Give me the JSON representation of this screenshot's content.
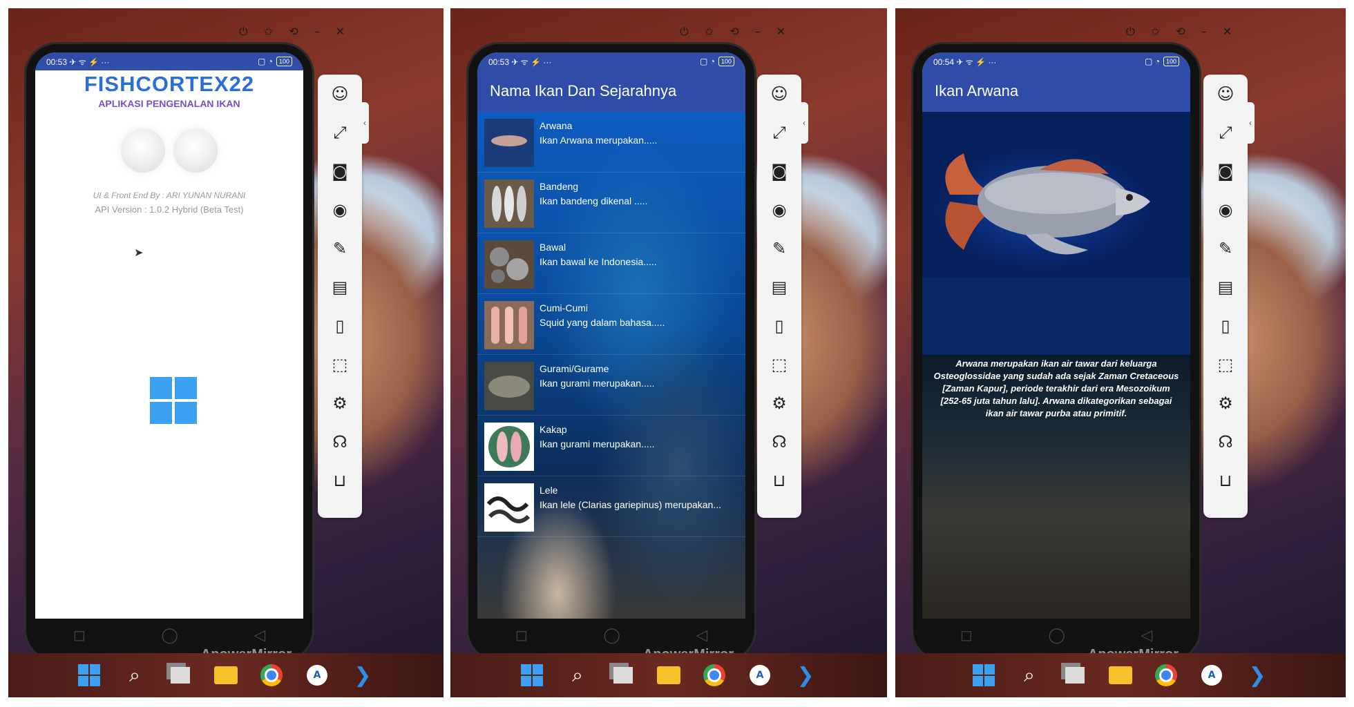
{
  "window_controls": "⏻ ✩ ⟲ – ✕",
  "status": {
    "time_1": "00:53",
    "time_2": "00:53",
    "time_3": "00:54",
    "battery": "100",
    "icons_left": "✈ ᯤ ⚡ ···",
    "icons_right": "▢ ◔"
  },
  "watermark": "ApowerMirror",
  "splash": {
    "title": "FISHCORTEX22",
    "subtitle": "APLIKASI PENGENALAN IKAN",
    "credit": "UI & Front End By : ARI YUNAN NURANI",
    "api_version": "API Version : 1.0.2 Hybrid (Beta Test)"
  },
  "list_screen": {
    "title": "Nama Ikan Dan Sejarahnya",
    "items": [
      {
        "name": "Arwana",
        "desc": "Ikan Arwana merupakan....."
      },
      {
        "name": "Bandeng",
        "desc": "Ikan bandeng dikenal ....."
      },
      {
        "name": "Bawal",
        "desc": "Ikan bawal ke Indonesia....."
      },
      {
        "name": "Cumi-Cumi",
        "desc": "Squid yang dalam bahasa....."
      },
      {
        "name": "Gurami/Gurame",
        "desc": "Ikan gurami merupakan....."
      },
      {
        "name": "Kakap",
        "desc": "Ikan gurami merupakan....."
      },
      {
        "name": "Lele",
        "desc": "Ikan lele (Clarias gariepinus) merupakan..."
      }
    ]
  },
  "detail_screen": {
    "title": "Ikan Arwana",
    "description": "Arwana merupakan ikan air tawar dari keluarga Osteoglossidae yang sudah ada sejak Zaman Cretaceous [Zaman Kapur], periode terakhir dari era Mesozoikum [252-65 juta tahun lalu]. Arwana dikategorikan sebagai ikan air tawar purba atau primitif."
  },
  "nav": {
    "recent": "◻",
    "home": "◯",
    "back": "◁"
  },
  "colors": {
    "appbar": "#2f4da8",
    "accent": "#2a6fd6",
    "windows_blue": "#3aa0f0"
  },
  "toolbar_icons": [
    "mascot-icon",
    "fullscreen-icon",
    "screenshot-icon",
    "record-icon",
    "brush-icon",
    "keyboard-icon",
    "screen-off-icon",
    "crop-icon",
    "settings-icon",
    "support-icon",
    "cart-icon"
  ],
  "taskbar_icons": [
    "windows-start-icon",
    "search-icon",
    "task-view-icon",
    "file-explorer-icon",
    "chrome-icon",
    "app-icon",
    "vscode-icon"
  ]
}
